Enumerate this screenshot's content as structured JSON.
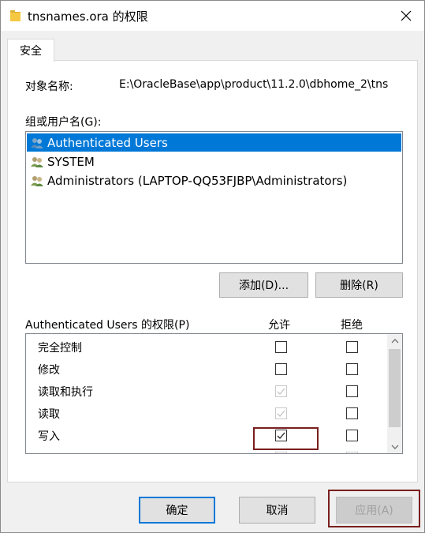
{
  "window": {
    "title": "tnsnames.ora 的权限"
  },
  "tabs": [
    {
      "label": "安全",
      "active": true
    }
  ],
  "object": {
    "label": "对象名称:",
    "value": "E:\\OracleBase\\app\\product\\11.2.0\\dbhome_2\\tns"
  },
  "groups": {
    "label": "组或用户名(G):",
    "items": [
      {
        "name": "Authenticated Users",
        "selected": true
      },
      {
        "name": "SYSTEM",
        "selected": false
      },
      {
        "name": "Administrators (LAPTOP-QQ53FJBP\\Administrators)",
        "selected": false
      }
    ],
    "add_label": "添加(D)...",
    "remove_label": "删除(R)"
  },
  "permissions": {
    "header": "Authenticated Users 的权限(P)",
    "allow_label": "允许",
    "deny_label": "拒绝",
    "rows": [
      {
        "name": "完全控制",
        "allow": "unchecked",
        "deny": "unchecked"
      },
      {
        "name": "修改",
        "allow": "unchecked",
        "deny": "unchecked"
      },
      {
        "name": "读取和执行",
        "allow": "checked-disabled",
        "deny": "unchecked"
      },
      {
        "name": "读取",
        "allow": "checked-disabled",
        "deny": "unchecked"
      },
      {
        "name": "写入",
        "allow": "checked",
        "deny": "unchecked"
      }
    ]
  },
  "buttons": {
    "ok": "确定",
    "cancel": "取消",
    "apply": "应用(A)"
  },
  "colors": {
    "selection": "#0078d7",
    "highlight_box": "#7a1f1f"
  },
  "icons": {
    "title": "folder-icon",
    "close": "close-icon",
    "user": "user-group-icon"
  }
}
